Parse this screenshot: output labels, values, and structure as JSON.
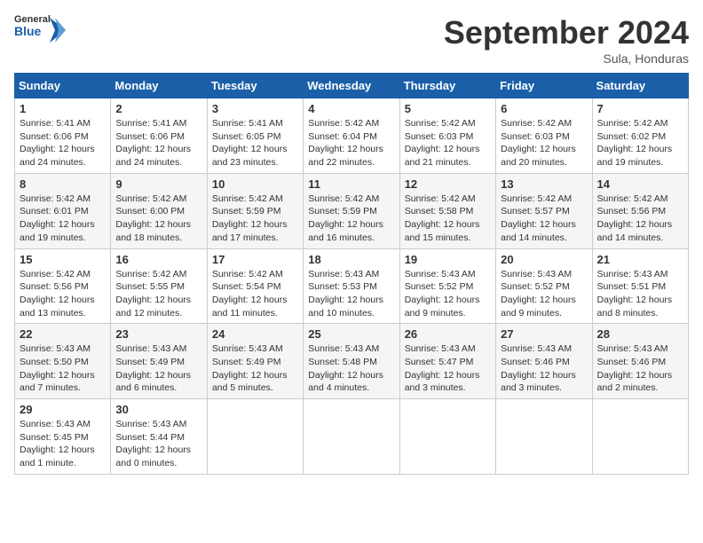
{
  "header": {
    "logo_general": "General",
    "logo_blue": "Blue",
    "month_title": "September 2024",
    "subtitle": "Sula, Honduras"
  },
  "weekdays": [
    "Sunday",
    "Monday",
    "Tuesday",
    "Wednesday",
    "Thursday",
    "Friday",
    "Saturday"
  ],
  "weeks": [
    [
      {
        "day": "1",
        "sunrise": "Sunrise: 5:41 AM",
        "sunset": "Sunset: 6:06 PM",
        "daylight": "Daylight: 12 hours and 24 minutes."
      },
      {
        "day": "2",
        "sunrise": "Sunrise: 5:41 AM",
        "sunset": "Sunset: 6:06 PM",
        "daylight": "Daylight: 12 hours and 24 minutes."
      },
      {
        "day": "3",
        "sunrise": "Sunrise: 5:41 AM",
        "sunset": "Sunset: 6:05 PM",
        "daylight": "Daylight: 12 hours and 23 minutes."
      },
      {
        "day": "4",
        "sunrise": "Sunrise: 5:42 AM",
        "sunset": "Sunset: 6:04 PM",
        "daylight": "Daylight: 12 hours and 22 minutes."
      },
      {
        "day": "5",
        "sunrise": "Sunrise: 5:42 AM",
        "sunset": "Sunset: 6:03 PM",
        "daylight": "Daylight: 12 hours and 21 minutes."
      },
      {
        "day": "6",
        "sunrise": "Sunrise: 5:42 AM",
        "sunset": "Sunset: 6:03 PM",
        "daylight": "Daylight: 12 hours and 20 minutes."
      },
      {
        "day": "7",
        "sunrise": "Sunrise: 5:42 AM",
        "sunset": "Sunset: 6:02 PM",
        "daylight": "Daylight: 12 hours and 19 minutes."
      }
    ],
    [
      {
        "day": "8",
        "sunrise": "Sunrise: 5:42 AM",
        "sunset": "Sunset: 6:01 PM",
        "daylight": "Daylight: 12 hours and 19 minutes."
      },
      {
        "day": "9",
        "sunrise": "Sunrise: 5:42 AM",
        "sunset": "Sunset: 6:00 PM",
        "daylight": "Daylight: 12 hours and 18 minutes."
      },
      {
        "day": "10",
        "sunrise": "Sunrise: 5:42 AM",
        "sunset": "Sunset: 5:59 PM",
        "daylight": "Daylight: 12 hours and 17 minutes."
      },
      {
        "day": "11",
        "sunrise": "Sunrise: 5:42 AM",
        "sunset": "Sunset: 5:59 PM",
        "daylight": "Daylight: 12 hours and 16 minutes."
      },
      {
        "day": "12",
        "sunrise": "Sunrise: 5:42 AM",
        "sunset": "Sunset: 5:58 PM",
        "daylight": "Daylight: 12 hours and 15 minutes."
      },
      {
        "day": "13",
        "sunrise": "Sunrise: 5:42 AM",
        "sunset": "Sunset: 5:57 PM",
        "daylight": "Daylight: 12 hours and 14 minutes."
      },
      {
        "day": "14",
        "sunrise": "Sunrise: 5:42 AM",
        "sunset": "Sunset: 5:56 PM",
        "daylight": "Daylight: 12 hours and 14 minutes."
      }
    ],
    [
      {
        "day": "15",
        "sunrise": "Sunrise: 5:42 AM",
        "sunset": "Sunset: 5:56 PM",
        "daylight": "Daylight: 12 hours and 13 minutes."
      },
      {
        "day": "16",
        "sunrise": "Sunrise: 5:42 AM",
        "sunset": "Sunset: 5:55 PM",
        "daylight": "Daylight: 12 hours and 12 minutes."
      },
      {
        "day": "17",
        "sunrise": "Sunrise: 5:42 AM",
        "sunset": "Sunset: 5:54 PM",
        "daylight": "Daylight: 12 hours and 11 minutes."
      },
      {
        "day": "18",
        "sunrise": "Sunrise: 5:43 AM",
        "sunset": "Sunset: 5:53 PM",
        "daylight": "Daylight: 12 hours and 10 minutes."
      },
      {
        "day": "19",
        "sunrise": "Sunrise: 5:43 AM",
        "sunset": "Sunset: 5:52 PM",
        "daylight": "Daylight: 12 hours and 9 minutes."
      },
      {
        "day": "20",
        "sunrise": "Sunrise: 5:43 AM",
        "sunset": "Sunset: 5:52 PM",
        "daylight": "Daylight: 12 hours and 9 minutes."
      },
      {
        "day": "21",
        "sunrise": "Sunrise: 5:43 AM",
        "sunset": "Sunset: 5:51 PM",
        "daylight": "Daylight: 12 hours and 8 minutes."
      }
    ],
    [
      {
        "day": "22",
        "sunrise": "Sunrise: 5:43 AM",
        "sunset": "Sunset: 5:50 PM",
        "daylight": "Daylight: 12 hours and 7 minutes."
      },
      {
        "day": "23",
        "sunrise": "Sunrise: 5:43 AM",
        "sunset": "Sunset: 5:49 PM",
        "daylight": "Daylight: 12 hours and 6 minutes."
      },
      {
        "day": "24",
        "sunrise": "Sunrise: 5:43 AM",
        "sunset": "Sunset: 5:49 PM",
        "daylight": "Daylight: 12 hours and 5 minutes."
      },
      {
        "day": "25",
        "sunrise": "Sunrise: 5:43 AM",
        "sunset": "Sunset: 5:48 PM",
        "daylight": "Daylight: 12 hours and 4 minutes."
      },
      {
        "day": "26",
        "sunrise": "Sunrise: 5:43 AM",
        "sunset": "Sunset: 5:47 PM",
        "daylight": "Daylight: 12 hours and 3 minutes."
      },
      {
        "day": "27",
        "sunrise": "Sunrise: 5:43 AM",
        "sunset": "Sunset: 5:46 PM",
        "daylight": "Daylight: 12 hours and 3 minutes."
      },
      {
        "day": "28",
        "sunrise": "Sunrise: 5:43 AM",
        "sunset": "Sunset: 5:46 PM",
        "daylight": "Daylight: 12 hours and 2 minutes."
      }
    ],
    [
      {
        "day": "29",
        "sunrise": "Sunrise: 5:43 AM",
        "sunset": "Sunset: 5:45 PM",
        "daylight": "Daylight: 12 hours and 1 minute."
      },
      {
        "day": "30",
        "sunrise": "Sunrise: 5:43 AM",
        "sunset": "Sunset: 5:44 PM",
        "daylight": "Daylight: 12 hours and 0 minutes."
      },
      null,
      null,
      null,
      null,
      null
    ]
  ]
}
